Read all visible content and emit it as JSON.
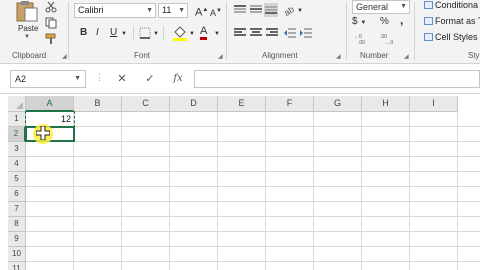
{
  "ribbon": {
    "clipboard": {
      "label": "Clipboard",
      "paste_label": "Paste"
    },
    "font": {
      "label": "Font",
      "font_name": "Calibri",
      "font_size": "11",
      "bold": "B",
      "italic": "I",
      "underline": "U",
      "grow_font": "A",
      "shrink_font": "A",
      "font_color_glyph": "A"
    },
    "alignment": {
      "label": "Alignment"
    },
    "number": {
      "label": "Number",
      "format": "General",
      "currency": "$",
      "percent": "%",
      "comma": ","
    },
    "styles": {
      "label": "Sty",
      "conditional": "Conditiona",
      "format_as": "Format as T",
      "cell_styles": "Cell Styles"
    }
  },
  "formula_bar": {
    "name_box": "A2",
    "cancel": "✕",
    "enter": "✓",
    "fx": "fx",
    "formula": ""
  },
  "grid": {
    "columns": [
      "A",
      "B",
      "C",
      "D",
      "E",
      "F",
      "G",
      "H",
      "I"
    ],
    "rows": [
      "1",
      "2",
      "3",
      "4",
      "5",
      "6",
      "7",
      "8",
      "9",
      "10",
      "11"
    ],
    "cell_A1": "12"
  },
  "colors": {
    "excel_green": "#217346",
    "highlight_yellow": "#fff03c"
  }
}
